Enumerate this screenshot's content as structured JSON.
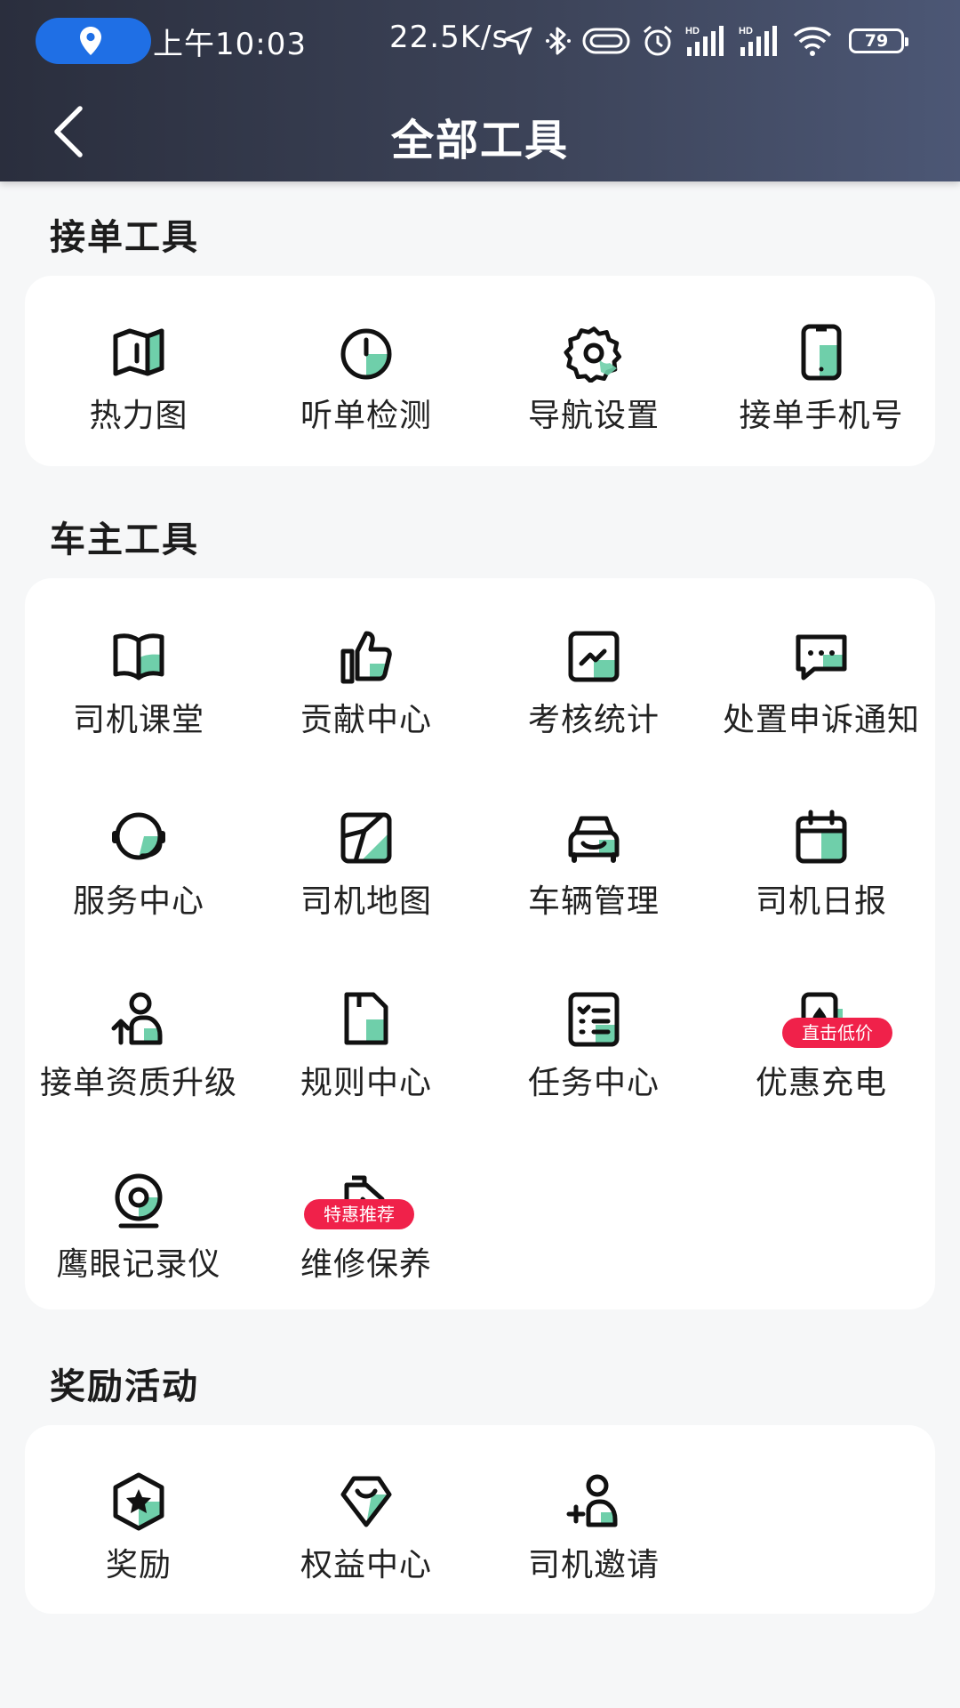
{
  "status_bar": {
    "time": "上午10:03",
    "net_speed": "22.5K/s",
    "battery": "79",
    "icons": [
      "location-icon",
      "navigation-arrow-icon",
      "bluetooth-icon",
      "nfc-icon",
      "alarm-icon",
      "signal-hd-icon",
      "signal-hd-icon",
      "wifi-icon",
      "battery-icon"
    ]
  },
  "header": {
    "title": "全部工具"
  },
  "sections": [
    {
      "title": "接单工具",
      "tools": [
        {
          "label": "热力图",
          "icon": "map-icon"
        },
        {
          "label": "听单检测",
          "icon": "clock-icon"
        },
        {
          "label": "导航设置",
          "icon": "gear-icon"
        },
        {
          "label": "接单手机号",
          "icon": "phone-icon"
        }
      ]
    },
    {
      "title": "车主工具",
      "tools": [
        {
          "label": "司机课堂",
          "icon": "book-icon"
        },
        {
          "label": "贡献中心",
          "icon": "thumbs-up-icon"
        },
        {
          "label": "考核统计",
          "icon": "chart-icon"
        },
        {
          "label": "处置申诉通知",
          "icon": "message-icon"
        },
        {
          "label": "服务中心",
          "icon": "headset-icon"
        },
        {
          "label": "司机地图",
          "icon": "map-square-icon"
        },
        {
          "label": "车辆管理",
          "icon": "car-icon"
        },
        {
          "label": "司机日报",
          "icon": "calendar-icon"
        },
        {
          "label": "接单资质升级",
          "icon": "user-upgrade-icon"
        },
        {
          "label": "规则中心",
          "icon": "document-icon"
        },
        {
          "label": "任务中心",
          "icon": "checklist-icon"
        },
        {
          "label": "优惠充电",
          "icon": "charging-icon",
          "badge": "直击低价"
        },
        {
          "label": "鹰眼记录仪",
          "icon": "camera-icon"
        },
        {
          "label": "维修保养",
          "icon": "oil-can-icon",
          "badge": "特惠推荐"
        }
      ]
    },
    {
      "title": "奖励活动",
      "tools": [
        {
          "label": "奖励",
          "icon": "star-badge-icon"
        },
        {
          "label": "权益中心",
          "icon": "gift-icon"
        },
        {
          "label": "司机邀请",
          "icon": "add-user-icon"
        }
      ]
    }
  ],
  "colors": {
    "accent_green": "#6fcfaa",
    "badge_red": "#f0214a",
    "header_dark": "#2a2e3d"
  }
}
